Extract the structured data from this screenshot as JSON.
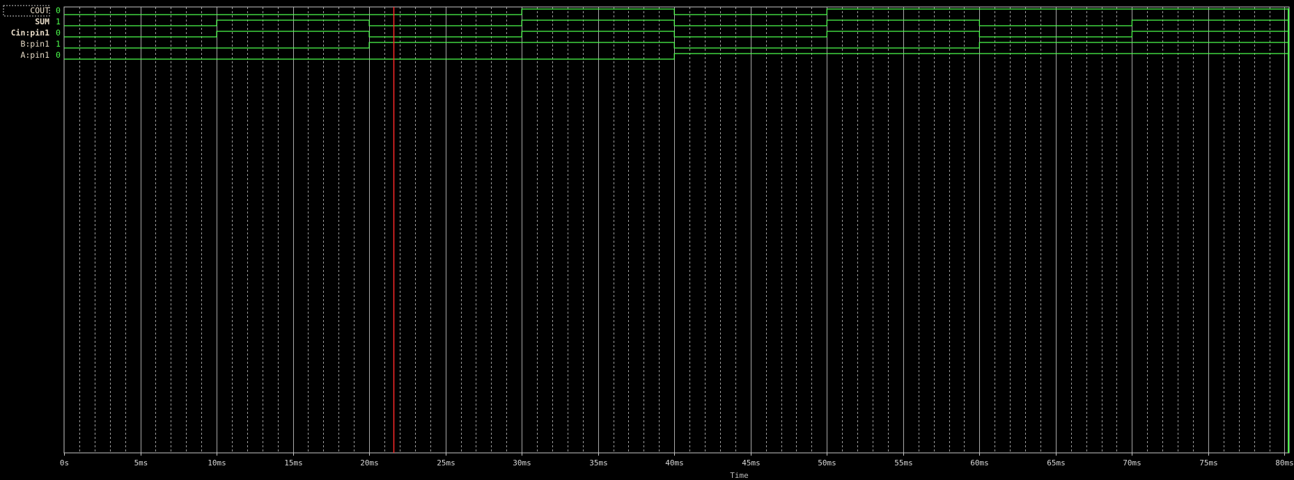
{
  "viewer": {
    "background": "#000000",
    "trace_color": "#4cff4c",
    "grid_color": "#c8c8c8",
    "cursor_color": "#ff2a2a",
    "label_color": "#e8dcc8"
  },
  "time_axis": {
    "title": "Time",
    "unit": "ms",
    "min": 0,
    "max": 80.3,
    "major_step": 5,
    "minor_step": 1,
    "tick_labels": [
      "0s",
      "5ms",
      "10ms",
      "15ms",
      "20ms",
      "25ms",
      "30ms",
      "35ms",
      "40ms",
      "45ms",
      "50ms",
      "55ms",
      "60ms",
      "65ms",
      "70ms",
      "75ms",
      "80ms"
    ]
  },
  "cursor": {
    "time_ms": 21.6
  },
  "signals": [
    {
      "name": "COUT",
      "value": "0",
      "selected": true,
      "bold": false,
      "transitions": [
        [
          0,
          0
        ],
        [
          30,
          1
        ],
        [
          40,
          0
        ],
        [
          50,
          1
        ],
        [
          80.3,
          1
        ]
      ]
    },
    {
      "name": "SUM",
      "value": "1",
      "selected": false,
      "bold": true,
      "transitions": [
        [
          0,
          0
        ],
        [
          10,
          1
        ],
        [
          20,
          0
        ],
        [
          30,
          1
        ],
        [
          40,
          0
        ],
        [
          50,
          1
        ],
        [
          60,
          0
        ],
        [
          70,
          1
        ],
        [
          80.3,
          1
        ]
      ]
    },
    {
      "name": "Cin:pin1",
      "value": "0",
      "selected": false,
      "bold": true,
      "transitions": [
        [
          0,
          0
        ],
        [
          10,
          1
        ],
        [
          20,
          0
        ],
        [
          30,
          1
        ],
        [
          40,
          0
        ],
        [
          50,
          1
        ],
        [
          60,
          0
        ],
        [
          70,
          1
        ],
        [
          80.3,
          1
        ]
      ]
    },
    {
      "name": "B:pin1",
      "value": "1",
      "selected": false,
      "bold": false,
      "transitions": [
        [
          0,
          0
        ],
        [
          20,
          1
        ],
        [
          40,
          0
        ],
        [
          60,
          1
        ],
        [
          80.3,
          1
        ]
      ]
    },
    {
      "name": "A:pin1",
      "value": "0",
      "selected": false,
      "bold": false,
      "transitions": [
        [
          0,
          0
        ],
        [
          40,
          1
        ],
        [
          80.3,
          1
        ]
      ]
    }
  ]
}
